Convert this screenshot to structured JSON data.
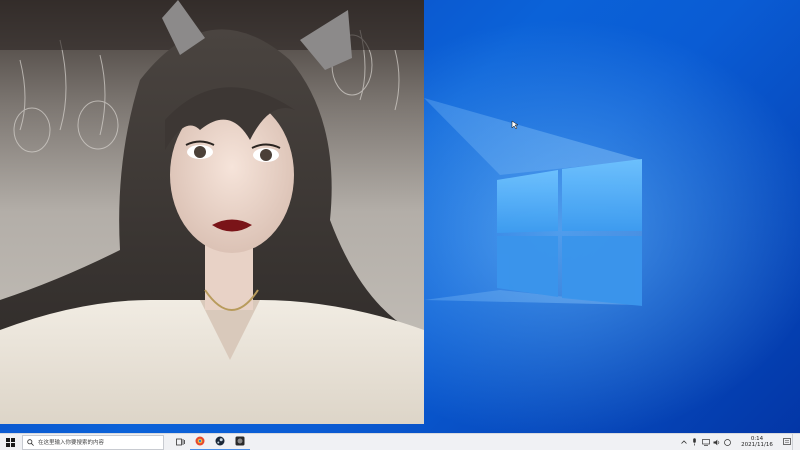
{
  "desktop": {
    "wallpaper": "windows-10-hero-blue",
    "accent": "#0a5cd4"
  },
  "photo_window": {
    "content": "selfie-photo"
  },
  "taskbar": {
    "search_placeholder": "在这里输入你要搜索的内容",
    "pinned": [
      {
        "name": "task-view-icon"
      },
      {
        "name": "browser-icon"
      },
      {
        "name": "steam-icon"
      },
      {
        "name": "app-icon"
      }
    ],
    "clock": {
      "time": "0:14",
      "date": "2021/11/16"
    }
  }
}
